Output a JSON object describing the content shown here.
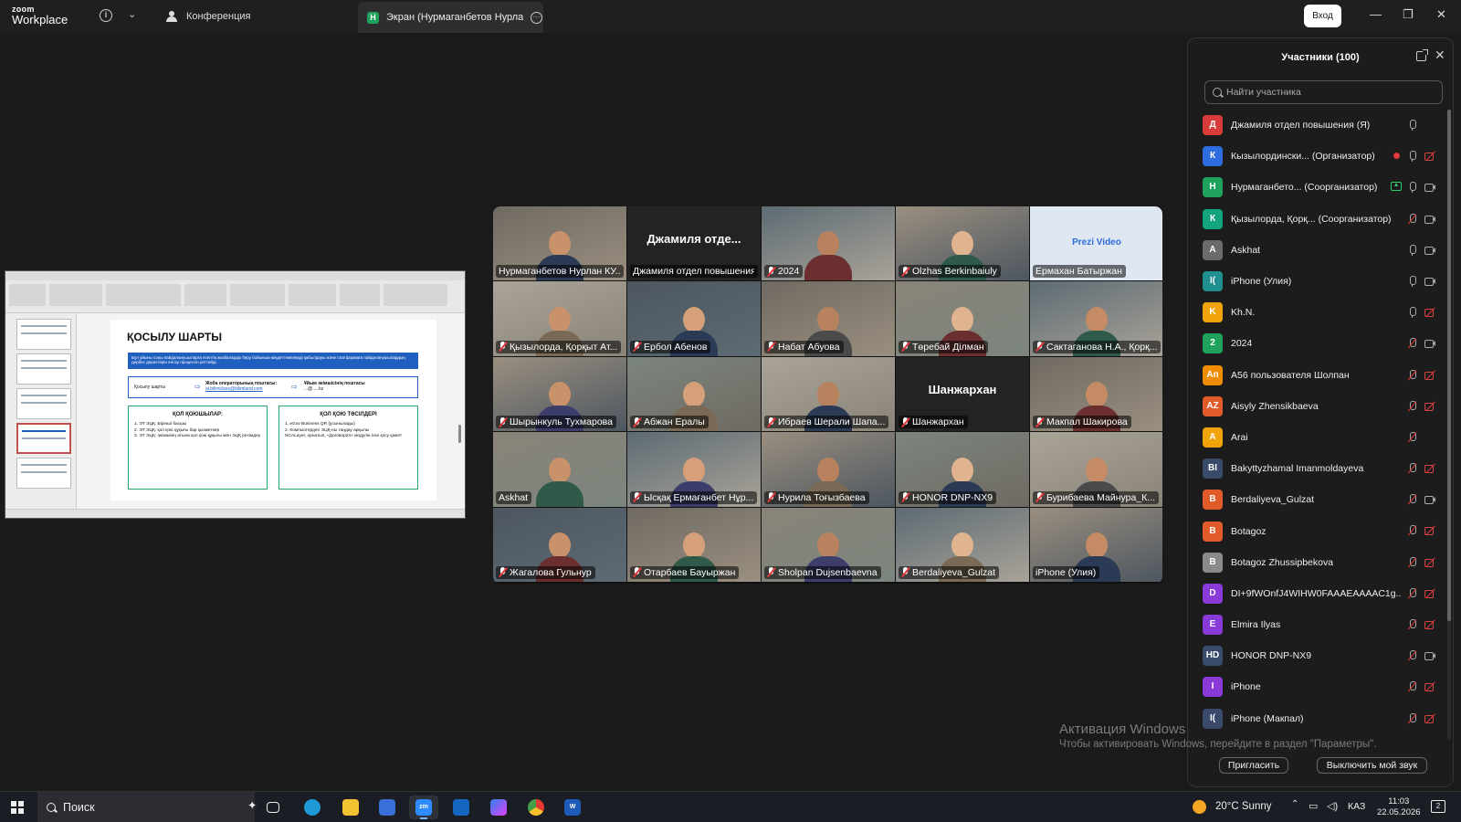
{
  "topbar": {
    "logo_line1": "zoom",
    "logo_line2": "Workplace",
    "conference_tab": "Конференция",
    "screen_tab_badge": "Н",
    "screen_tab_title": "Экран (Нурмаганбетов Нурлан КУ",
    "signin_label": "Вход"
  },
  "shared_slide": {
    "title": "ҚОСЫЛУ ШАРТЫ",
    "banner": "Бұл уйыны соңы пайдаланушыларға есептік жазбаларды беру бойынша міндеттемелерді қабылдауы және платформага пайдаланушылардың дербес деректерін енгізу процессін реттейді.",
    "row_left": "Қосылу шарты",
    "row_mid_title": "Жоба операторының поштасы:",
    "row_mid_email": "ai.bilimclass@bilimland.com",
    "row_right_title": "Ұйым әкімшісінің поштасы",
    "row_right_value": "...@.....kz",
    "left_box_title": "ҚОЛ ҚОЮШЫЛАР:",
    "left_box_items": [
      "1. ЭТ ЭЦҚ: Бірінші басшы",
      "2. ЭТ ЭЦҚ: қол қою құқығы бар қызметкер",
      "3. ЭТ ЭЦҚ: әкімшінің атына қол қою құқығы мен ЭЦҚ ресімдеу"
    ],
    "right_box_title": "ҚОЛ ҚОЮ ТӘСІЛДЕРІ",
    "right_box_items": [
      "1. eGov Business QR (ұсынылады)",
      "2. Компьютердегі ЭЦҚ-ны таңдау арқылы",
      "NCALayer, орнатып, «Договор24» модулін іске қосу қажет"
    ]
  },
  "grid": {
    "tiles": [
      {
        "name": "Нурмаганбетов Нурлан КУ...",
        "muted": false,
        "video": true
      },
      {
        "name": "Джамиля отдел повышения",
        "muted": false,
        "video": false,
        "bigname": "Джамиля отде..."
      },
      {
        "name": "2024",
        "muted": true,
        "video": true
      },
      {
        "name": "Olzhas Berkinbaiuly",
        "muted": true,
        "video": true
      },
      {
        "name": "Ермахан Батыржан",
        "muted": false,
        "video": false,
        "prezi": "Prezi Video"
      },
      {
        "name": "Қызылорда, Қорқыт Ат...",
        "muted": true,
        "video": true
      },
      {
        "name": "Ербол Абенов",
        "muted": true,
        "video": true
      },
      {
        "name": "Набат Абуова",
        "muted": true,
        "video": true
      },
      {
        "name": "Төребай Ділман",
        "muted": true,
        "video": true
      },
      {
        "name": "Сактаганова Н.А., Қорқ...",
        "muted": true,
        "video": true
      },
      {
        "name": "Шырынкуль Тухмарова",
        "muted": true,
        "video": true
      },
      {
        "name": "Абжан Ералы",
        "muted": true,
        "video": true
      },
      {
        "name": "Ибраев Шерали Шапа...",
        "muted": true,
        "video": true
      },
      {
        "name": "Шанжархан",
        "muted": true,
        "video": false,
        "bigname": "Шанжархан"
      },
      {
        "name": "Макпал Шакирова",
        "muted": true,
        "video": true
      },
      {
        "name": "Askhat",
        "muted": false,
        "video": true,
        "active": true
      },
      {
        "name": "Ысқақ Ермағанбет Нұр...",
        "muted": true,
        "video": true
      },
      {
        "name": "Нурила Тоғызбаева",
        "muted": true,
        "video": true
      },
      {
        "name": "HONOR DNP-NX9",
        "muted": true,
        "video": true
      },
      {
        "name": "Бурибаева Майнура_К...",
        "muted": true,
        "video": true
      },
      {
        "name": "Жагалова Гульнур",
        "muted": true,
        "video": true
      },
      {
        "name": "Отарбаев Бауыржан",
        "muted": true,
        "video": true
      },
      {
        "name": "Sholpan Dujsenbaevna",
        "muted": true,
        "video": true
      },
      {
        "name": "Berdaliyeva_Gulzat",
        "muted": true,
        "video": true
      },
      {
        "name": "iPhone (Улия)",
        "muted": false,
        "video": true
      }
    ]
  },
  "participants": {
    "title": "Участники (100)",
    "search_placeholder": "Найти участника",
    "list": [
      {
        "initials": "Д",
        "color": "#d93a3a",
        "name": "Джамиля отдел повышения (Я)",
        "mic": "on",
        "cam": "none"
      },
      {
        "initials": "К",
        "color": "#2d6cdf",
        "name": "Кызылордински... (Организатор)",
        "mic": "on",
        "cam": "off",
        "rec": true
      },
      {
        "initials": "Н",
        "color": "#1fa35c",
        "name": "Нурмаганбето... (Соорганизатор)",
        "mic": "on",
        "cam": "on",
        "share": true
      },
      {
        "initials": "К",
        "color": "#14a37f",
        "name": "Қызылорда, Қорқ... (Соорганизатор)",
        "mic": "off",
        "cam": "on"
      },
      {
        "initials": "A",
        "color": "#6b6b6b",
        "name": "Askhat",
        "mic": "on",
        "cam": "on",
        "photo": true
      },
      {
        "initials": "I(",
        "color": "#1f8f8f",
        "name": "iPhone (Улия)",
        "mic": "on",
        "cam": "on"
      },
      {
        "initials": "K",
        "color": "#f0a30a",
        "name": "Kh.N.",
        "mic": "on",
        "cam": "off"
      },
      {
        "initials": "2",
        "color": "#1fa35c",
        "name": "2024",
        "mic": "off",
        "cam": "on"
      },
      {
        "initials": "Ап",
        "color": "#f08c00",
        "name": "А56 пользователя Шолпан",
        "mic": "off",
        "cam": "off"
      },
      {
        "initials": "AZ",
        "color": "#e05a2a",
        "name": "Aisyly Zhensikbaeva",
        "mic": "off",
        "cam": "off"
      },
      {
        "initials": "A",
        "color": "#f0a30a",
        "name": "Arai",
        "mic": "off",
        "cam": "none"
      },
      {
        "initials": "BI",
        "color": "#3a4a6b",
        "name": "Bakyttyzhamal Imanmoldayeva",
        "mic": "off",
        "cam": "off"
      },
      {
        "initials": "B",
        "color": "#e05a2a",
        "name": "Berdaliyeva_Gulzat",
        "mic": "off",
        "cam": "on"
      },
      {
        "initials": "B",
        "color": "#e05a2a",
        "name": "Botagoz",
        "mic": "off",
        "cam": "off"
      },
      {
        "initials": "B",
        "color": "#8a8a8a",
        "name": "Botagoz Zhussipbekova",
        "mic": "off",
        "cam": "off",
        "photo": true
      },
      {
        "initials": "D",
        "color": "#8a3ad9",
        "name": "DI+9fWOnfJ4WIHW0FAAAEAAAAC1g...",
        "mic": "off",
        "cam": "off"
      },
      {
        "initials": "E",
        "color": "#8a3ad9",
        "name": "Elmira Ilyas",
        "mic": "off",
        "cam": "off"
      },
      {
        "initials": "HD",
        "color": "#3a4a6b",
        "name": "HONOR DNP-NX9",
        "mic": "off",
        "cam": "on"
      },
      {
        "initials": "I",
        "color": "#8a3ad9",
        "name": "iPhone",
        "mic": "off",
        "cam": "off"
      },
      {
        "initials": "I(",
        "color": "#3a4a6b",
        "name": "iPhone (Макпал)",
        "mic": "off",
        "cam": "off"
      },
      {
        "initials": "",
        "color": "#f0a30a",
        "name": "",
        "mic": "off",
        "cam": "off"
      }
    ],
    "invite_label": "Пригласить",
    "mute_me_label": "Выключить мой звук"
  },
  "watermark": {
    "line1": "Активация Windows",
    "line2": "Чтобы активировать Windows, перейдите в раздел \"Параметры\"."
  },
  "taskbar": {
    "search_label": "Поиск",
    "weather": "20°C  Sunny",
    "lang": "КАЗ",
    "time": "11:03",
    "date": "22.05.2026",
    "notif_count": "2"
  }
}
